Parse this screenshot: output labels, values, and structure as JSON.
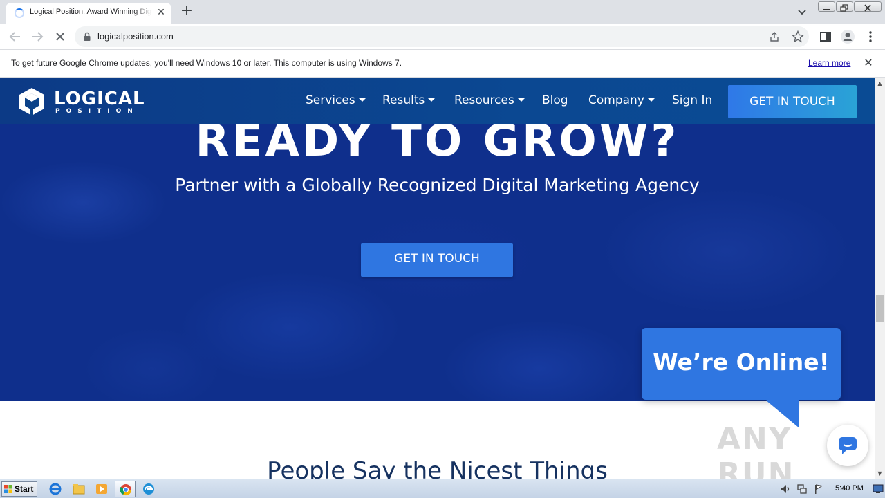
{
  "browser": {
    "tab_title": "Logical Position: Award Winning Digit",
    "url": "logicalposition.com",
    "infobar_message": "To get future Google Chrome updates, you'll need Windows 10 or later. This computer is using Windows 7.",
    "infobar_link": "Learn more"
  },
  "site": {
    "logo_word1": "LOGICAL",
    "logo_word2": "POSITION",
    "nav": {
      "services": "Services",
      "results": "Results",
      "resources": "Resources",
      "blog": "Blog",
      "company": "Company",
      "sign_in": "Sign In",
      "cta": "GET IN TOUCH"
    },
    "hero": {
      "title": "READY TO GROW?",
      "subtitle": "Partner with a Globally Recognized Digital Marketing Agency",
      "cta": "GET IN TOUCH"
    },
    "testimonials_heading": "People Say the Nicest Things",
    "chat_bubble": "We’re Online!",
    "watermark": "ANY RUN"
  },
  "taskbar": {
    "start": "Start",
    "clock": "5:40 PM"
  },
  "colors": {
    "nav_bg": "#0b4892",
    "hero_bg": "#0f2f8c",
    "cta_blue": "#2f76e1",
    "heading_navy": "#163260"
  },
  "icons": {
    "tab_loading": "spinner-icon",
    "tab_close": "close-icon",
    "new_tab": "plus-icon",
    "back": "arrow-left-icon",
    "forward": "arrow-right-icon",
    "stop": "close-icon",
    "lock": "lock-icon",
    "share": "share-icon",
    "bookmark": "star-icon",
    "side_panel": "side-panel-icon",
    "profile": "profile-icon",
    "menu": "kebab-menu-icon",
    "chat": "chat-icon"
  }
}
